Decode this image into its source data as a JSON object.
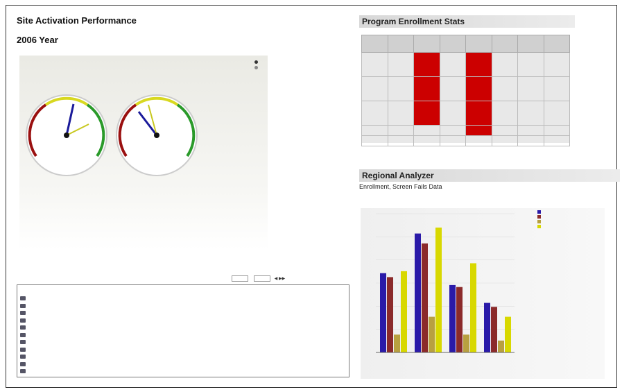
{
  "header": {
    "title": "Site Activation Performance",
    "subtitle": "",
    "year": "2006 Year"
  },
  "gauges": {
    "legend": [
      "",
      ""
    ],
    "labels": [
      "",
      ""
    ],
    "footer": ""
  },
  "list": {
    "label": "",
    "pager": {
      "prefix": "",
      "of": ""
    },
    "column_header": "",
    "items": [
      "",
      "",
      "",
      "",
      "",
      "",
      "",
      "",
      "",
      "",
      ""
    ]
  },
  "enrollment": {
    "title": "Program Enrollment Stats",
    "columns": [
      "",
      "",
      "",
      "",
      "",
      "",
      "",
      ""
    ],
    "rows": [
      [
        "",
        "",
        "",
        "",
        "",
        "",
        "",
        ""
      ],
      [
        "",
        "",
        "",
        "",
        "",
        "",
        "",
        ""
      ],
      [
        "",
        "",
        "",
        "",
        "",
        "",
        "",
        ""
      ]
    ],
    "total_row": [
      "",
      "",
      "",
      "",
      "",
      "",
      "",
      ""
    ],
    "grand_row": [
      "",
      "",
      "",
      "",
      "",
      "",
      "",
      ""
    ]
  },
  "regional": {
    "title": "Regional Analyzer",
    "subtitle": "Enrollment, Screen Fails Data"
  },
  "colors": {
    "series1": "#2a1aa8",
    "series2": "#8b2a2a",
    "series3": "#b8a040",
    "series4": "#d8d800",
    "red_cell": "#cc0000"
  },
  "chart_data": {
    "type": "bar",
    "title": "",
    "xlabel": "",
    "ylabel": "",
    "ylim": [
      0,
      7
    ],
    "categories": [
      "",
      "",
      "",
      ""
    ],
    "legend_title": "",
    "series": [
      {
        "name": "",
        "values": [
          4.0,
          6.0,
          3.4,
          2.5
        ]
      },
      {
        "name": "",
        "values": [
          3.8,
          5.5,
          3.3,
          2.3
        ]
      },
      {
        "name": "",
        "values": [
          0.9,
          1.8,
          0.9,
          0.6
        ]
      },
      {
        "name": "",
        "values": [
          4.1,
          6.3,
          4.5,
          1.8
        ]
      }
    ]
  }
}
